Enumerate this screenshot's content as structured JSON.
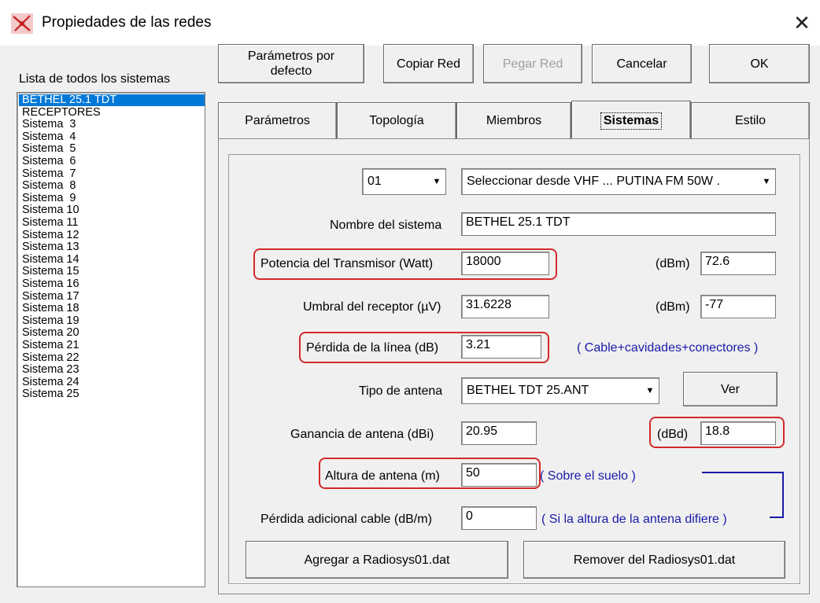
{
  "window": {
    "title": "Propiedades de las redes",
    "close_glyph": "✕",
    "icon": "network-app-icon"
  },
  "systems_list": {
    "label": "Lista de todos los sistemas",
    "items": [
      "BETHEL 25.1 TDT",
      "RECEPTORES",
      "Sistema  3",
      "Sistema  4",
      "Sistema  5",
      "Sistema  6",
      "Sistema  7",
      "Sistema  8",
      "Sistema  9",
      "Sistema 10",
      "Sistema 11",
      "Sistema 12",
      "Sistema 13",
      "Sistema 14",
      "Sistema 15",
      "Sistema 16",
      "Sistema 17",
      "Sistema 18",
      "Sistema 19",
      "Sistema 20",
      "Sistema 21",
      "Sistema 22",
      "Sistema 23",
      "Sistema 24",
      "Sistema 25"
    ],
    "selected_index": 0
  },
  "toolbar": {
    "defaults_line1": "Parámetros por",
    "defaults_line2": "defecto",
    "copy": "Copiar Red",
    "paste": "Pegar Red",
    "cancel": "Cancelar",
    "ok": "OK"
  },
  "tabs": [
    {
      "label": "Parámetros",
      "active": false
    },
    {
      "label": "Topología",
      "active": false
    },
    {
      "label": "Miembros",
      "active": false
    },
    {
      "label": "Sistemas",
      "active": true
    },
    {
      "label": "Estilo",
      "active": false
    }
  ],
  "form": {
    "system_number": "01",
    "system_source": "Seleccionar desde VHF ... PUTINA FM 50W .",
    "name_label": "Nombre del sistema",
    "name_value": "BETHEL 25.1 TDT",
    "power_label": "Potencia del Transmisor (Watt)",
    "power_value": "18000",
    "power_dbm_label": "(dBm)",
    "power_dbm_value": "72.6",
    "threshold_label": "Umbral del receptor (µV)",
    "threshold_value": "31.6228",
    "threshold_dbm_label": "(dBm)",
    "threshold_dbm_value": "-77",
    "line_loss_label": "Pérdida de la línea (dB)",
    "line_loss_value": "3.21",
    "line_loss_note": "( Cable+cavidades+conectores )",
    "antenna_type_label": "Tipo de antena",
    "antenna_type_value": "BETHEL TDT 25.ANT",
    "view_button": "Ver",
    "gain_label": "Ganancia de antena (dBi)",
    "gain_value": "20.95",
    "gain_dbd_label": "(dBd)",
    "gain_dbd_value": "18.8",
    "height_label": "Altura de antena (m)",
    "height_value": "50",
    "height_note": "( Sobre el suelo )",
    "extra_loss_label": "Pérdida adicional cable (dB/m)",
    "extra_loss_value": "0",
    "extra_loss_note": "( Si la altura de la antena difiere )",
    "add_button": "Agregar a Radiosys01.dat",
    "remove_button": "Remover del Radiosys01.dat"
  },
  "colors": {
    "highlight": "#d32a2a",
    "note": "#1a1aa8",
    "selection": "#0078d7"
  }
}
